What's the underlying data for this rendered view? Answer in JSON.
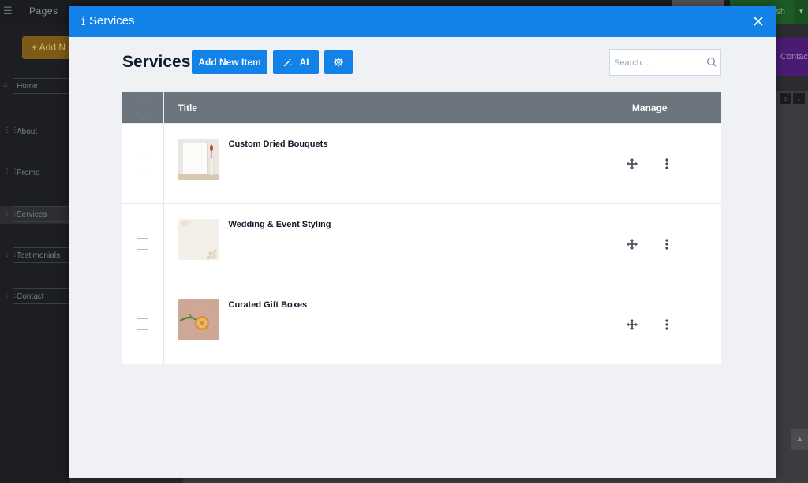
{
  "background": {
    "sidebar_title": "Pages",
    "add_new_label": "+ Add N",
    "pages": [
      {
        "label": "Home",
        "icon": "home-icon"
      },
      {
        "label": "About",
        "icon": "drag-handle-icon"
      },
      {
        "label": "Promo",
        "icon": "drag-handle-icon"
      },
      {
        "label": "Services",
        "icon": "drag-handle-icon"
      },
      {
        "label": "Testimonials",
        "icon": "drag-handle-icon"
      },
      {
        "label": "Contact",
        "icon": "drag-handle-icon"
      }
    ],
    "publish_label": "sh",
    "contact_button_label": "Contac"
  },
  "modal": {
    "title": "Services",
    "heading": "Services",
    "add_button_label": "Add New Item",
    "ai_button_label": "AI",
    "search_placeholder": "Search...",
    "table": {
      "headers": {
        "title": "Title",
        "manage": "Manage"
      },
      "rows": [
        {
          "title": "Custom Dried Bouquets",
          "thumb": "vase-with-dried-flower"
        },
        {
          "title": "Wedding & Event Styling",
          "thumb": "light-floral-texture"
        },
        {
          "title": "Curated Gift Boxes",
          "thumb": "citrus-gift-box"
        }
      ]
    }
  },
  "colors": {
    "accent": "#1282e8",
    "table_header": "#6c757d",
    "modal_bg": "#f0f1f4",
    "text_dark": "#0f1b33"
  }
}
